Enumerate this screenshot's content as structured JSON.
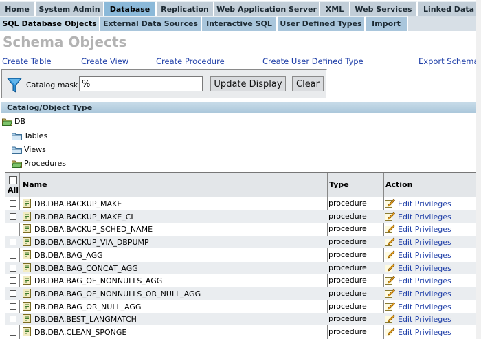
{
  "main_tabs": [
    {
      "label": "Home"
    },
    {
      "label": "System Admin"
    },
    {
      "label": "Database"
    },
    {
      "label": "Replication"
    },
    {
      "label": "Web Application Server"
    },
    {
      "label": "XML"
    },
    {
      "label": "Web Services"
    },
    {
      "label": "Linked Data"
    }
  ],
  "sub_tabs": [
    {
      "label": "SQL Database Objects"
    },
    {
      "label": "External Data Sources"
    },
    {
      "label": "Interactive SQL"
    },
    {
      "label": "User Defined Types"
    },
    {
      "label": "Import"
    }
  ],
  "page_title": "Schema Objects",
  "actions": {
    "create_table": "Create Table",
    "create_view": "Create View",
    "create_procedure": "Create Procedure",
    "create_udt": "Create User Defined Type",
    "export_schema": "Export Schema"
  },
  "filter": {
    "label": "Catalog mask",
    "value": "%",
    "update_label": "Update Display",
    "clear_label": "Clear"
  },
  "tree_header": "Catalog/Object Type",
  "tree": {
    "root": "DB",
    "tables": "Tables",
    "views": "Views",
    "procedures": "Procedures"
  },
  "grid": {
    "all_label": "All",
    "col_name": "Name",
    "col_type": "Type",
    "col_action": "Action",
    "rows": [
      {
        "name": "DB.DBA.BACKUP_MAKE",
        "type": "procedure",
        "action": "Edit Privileges"
      },
      {
        "name": "DB.DBA.BACKUP_MAKE_CL",
        "type": "procedure",
        "action": "Edit Privileges"
      },
      {
        "name": "DB.DBA.BACKUP_SCHED_NAME",
        "type": "procedure",
        "action": "Edit Privileges"
      },
      {
        "name": "DB.DBA.BACKUP_VIA_DBPUMP",
        "type": "procedure",
        "action": "Edit Privileges"
      },
      {
        "name": "DB.DBA.BAG_AGG",
        "type": "procedure",
        "action": "Edit Privileges"
      },
      {
        "name": "DB.DBA.BAG_CONCAT_AGG",
        "type": "procedure",
        "action": "Edit Privileges"
      },
      {
        "name": "DB.DBA.BAG_OF_NONNULLS_AGG",
        "type": "procedure",
        "action": "Edit Privileges"
      },
      {
        "name": "DB.DBA.BAG_OF_NONNULLS_OR_NULL_AGG",
        "type": "procedure",
        "action": "Edit Privileges"
      },
      {
        "name": "DB.DBA.BAG_OR_NULL_AGG",
        "type": "procedure",
        "action": "Edit Privileges"
      },
      {
        "name": "DB.DBA.BEST_LANGMATCH",
        "type": "procedure",
        "action": "Edit Privileges"
      },
      {
        "name": "DB.DBA.CLEAN_SPONGE",
        "type": "procedure",
        "action": "Edit Privileges"
      }
    ]
  }
}
